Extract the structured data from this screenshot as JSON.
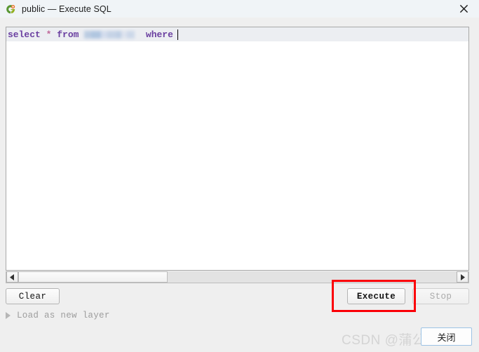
{
  "window": {
    "title": "public — Execute SQL",
    "icon": "qgis-logo-icon",
    "close_icon": "close-icon"
  },
  "editor": {
    "sql": {
      "keyword_select": "select",
      "operator_star": "*",
      "keyword_from": "from",
      "redacted_table": "",
      "keyword_where": "where"
    },
    "colors": {
      "keyword": "#6a3fa0",
      "operator": "#c06a9a",
      "current_line_highlight": "#eceef2",
      "background": "#ffffff"
    }
  },
  "scrollbar": {
    "left_arrow_icon": "triangle-left-icon",
    "right_arrow_icon": "triangle-right-icon",
    "thumb_position_percent": 0,
    "thumb_width_percent": 34
  },
  "toolbar": {
    "clear_label": "Clear",
    "execute_label": "Execute",
    "stop_label": "Stop",
    "stop_enabled": false
  },
  "annotation": {
    "color": "#fb0007",
    "targets": "Execute"
  },
  "load_layer": {
    "label": "Load as new layer",
    "expanded": false,
    "disclosure_icon": "triangle-right-icon"
  },
  "watermark": {
    "text": "CSDN @蒲公英smile"
  },
  "dialog_buttons": {
    "close_label": "关闭"
  }
}
